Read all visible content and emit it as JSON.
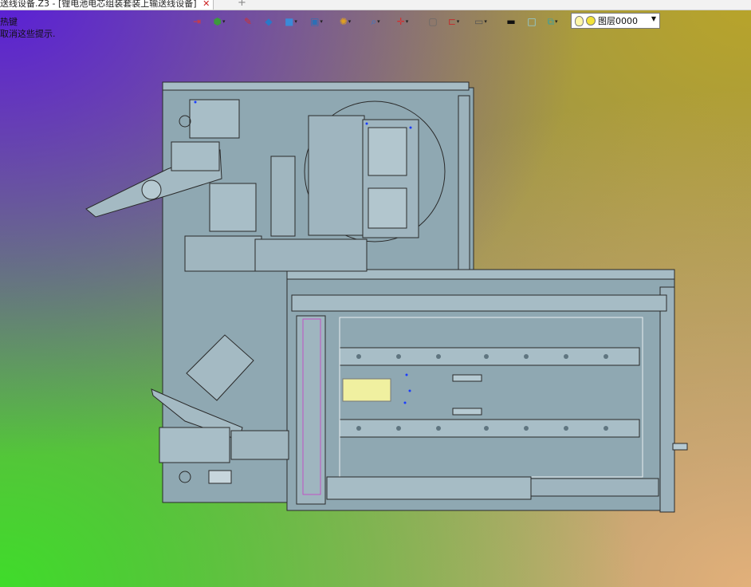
{
  "tab": {
    "title": "送线设备.Z3 - [锂电池电芯组装套装上输送线设备]",
    "close_glyph": "✕",
    "add_glyph": "+"
  },
  "hint": {
    "line1": "热键",
    "line2": "取消这些提示."
  },
  "toolbar": {
    "buttons": [
      {
        "name": "exit-icon",
        "glyph": "⇥",
        "color": "#d83a3a",
        "dropdown": false
      },
      {
        "name": "component-icon",
        "glyph": "⬢",
        "color": "#3c9a3c",
        "dropdown": true
      },
      {
        "name": "pencil-icon",
        "glyph": "✎",
        "color": "#d03030",
        "dropdown": false
      },
      {
        "name": "solid-box-icon",
        "glyph": "◆",
        "color": "#2a78c8",
        "dropdown": false
      },
      {
        "name": "cube-icon",
        "glyph": "■",
        "color": "#3a8ad8",
        "dropdown": true
      },
      {
        "name": "view-cube-icon",
        "glyph": "▣",
        "color": "#2d6fb5",
        "dropdown": true
      },
      {
        "name": "render-mode-icon",
        "glyph": "✺",
        "color": "#e0a020",
        "dropdown": true
      },
      {
        "name": "zoom-icon",
        "glyph": "⌕",
        "color": "#2a7ad0",
        "dropdown": true
      },
      {
        "name": "axis-icon",
        "glyph": "✛",
        "color": "#d23030",
        "dropdown": true
      },
      {
        "name": "frame-icon",
        "glyph": "▢",
        "color": "#666666",
        "dropdown": false
      },
      {
        "name": "dimension-icon",
        "glyph": "⊏",
        "color": "#c03030",
        "dropdown": true
      },
      {
        "name": "display-icon",
        "glyph": "▭",
        "color": "#555555",
        "dropdown": true
      },
      {
        "name": "line-style-icon",
        "glyph": "▬",
        "color": "#111111",
        "dropdown": false
      },
      {
        "name": "color-swatch-icon",
        "glyph": "□",
        "color": "#8fd8f0",
        "dropdown": false
      },
      {
        "name": "layer-stack-icon",
        "glyph": "⧉",
        "color": "#3aa0a0",
        "dropdown": true
      }
    ]
  },
  "layer_selector": {
    "value": "图层0000"
  },
  "colors": {
    "machine_fill": "#8fa8b2",
    "machine_line": "#2a2a2a",
    "accent_blue": "#1a3cff",
    "highlight_yellow": "#f0f0a0"
  }
}
